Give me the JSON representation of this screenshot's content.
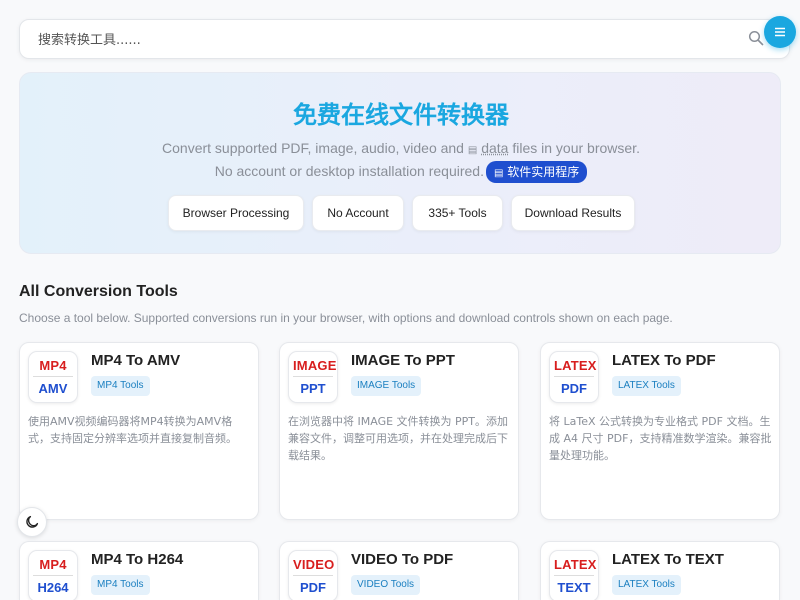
{
  "search": {
    "placeholder": "搜索转换工具......"
  },
  "hero": {
    "title": "免费在线文件转换器",
    "line1": "Convert supported PDF, image, audio, video and ",
    "data_word": "data",
    "line1_end": " files in your browser.",
    "line2": "No account or desktop installation required.",
    "utility_badge": "软件实用程序",
    "features": [
      "Browser Processing",
      "No Account",
      "335+ Tools",
      "Download Results"
    ]
  },
  "section": {
    "title": "All Conversion Tools",
    "subtitle": "Choose a tool below. Supported conversions run in your browser, with options and download controls shown on each page."
  },
  "cards": [
    {
      "from": "MP4",
      "to": "AMV",
      "title": "MP4 To AMV",
      "tag": "MP4 Tools",
      "desc": "使用AMV视频编码器将MP4转换为AMV格式，支持固定分辨率选项并直接复制音频。"
    },
    {
      "from": "IMAGE",
      "to": "PPT",
      "title": "IMAGE To PPT",
      "tag": "IMAGE Tools",
      "desc": "在浏览器中将 IMAGE 文件转换为 PPT。添加兼容文件，调整可用选项，并在处理完成后下载结果。"
    },
    {
      "from": "LATEX",
      "to": "PDF",
      "title": "LATEX To PDF",
      "tag": "LATEX Tools",
      "desc": "将 LaTeX 公式转换为专业格式 PDF 文档。生成 A4 尺寸 PDF，支持精准数学渲染。兼容批量处理功能。"
    },
    {
      "from": "MP4",
      "to": "H264",
      "title": "MP4 To H264",
      "tag": "MP4 Tools",
      "desc": ""
    },
    {
      "from": "VIDEO",
      "to": "PDF",
      "title": "VIDEO To PDF",
      "tag": "VIDEO Tools",
      "desc": ""
    },
    {
      "from": "LATEX",
      "to": "TEXT",
      "title": "LATEX To TEXT",
      "tag": "LATEX Tools",
      "desc": ""
    }
  ],
  "colors": {
    "accent": "#1aa7e0",
    "badge": "#1f4fcf",
    "from_format": "#d81e1e",
    "to_format": "#1f4fcf"
  },
  "icons": {
    "search": "search-icon",
    "menu": "menu-icon",
    "theme": "moon-icon",
    "document": "document-icon"
  }
}
